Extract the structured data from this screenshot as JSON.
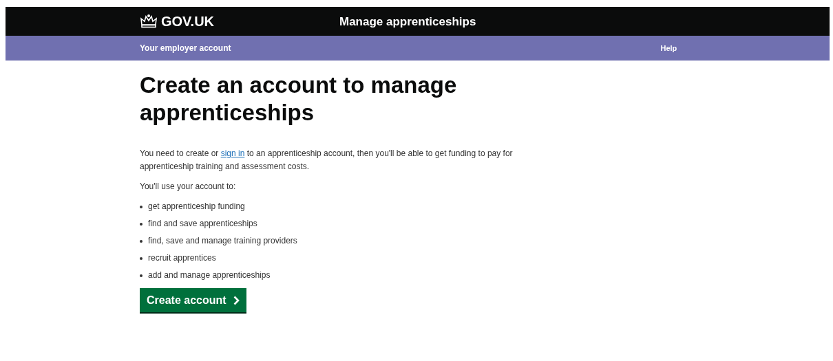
{
  "header": {
    "logo": "GOV.UK",
    "service": "Manage apprenticeships"
  },
  "nav": {
    "account": "Your employer account",
    "help": "Help"
  },
  "heading": "Create an account to manage apprenticeships",
  "intro": {
    "before": "You need to create or ",
    "link": "sign in",
    "after": " to an apprenticeship account, then you'll be able to get funding to pay for apprenticeship training and assessment costs."
  },
  "list_intro": "You'll use your account to:",
  "uses": [
    "get apprenticeship funding",
    "find and save apprenticeships",
    "find, save and manage training providers",
    "recruit apprentices",
    "add and manage apprenticeships"
  ],
  "button": "Create account"
}
